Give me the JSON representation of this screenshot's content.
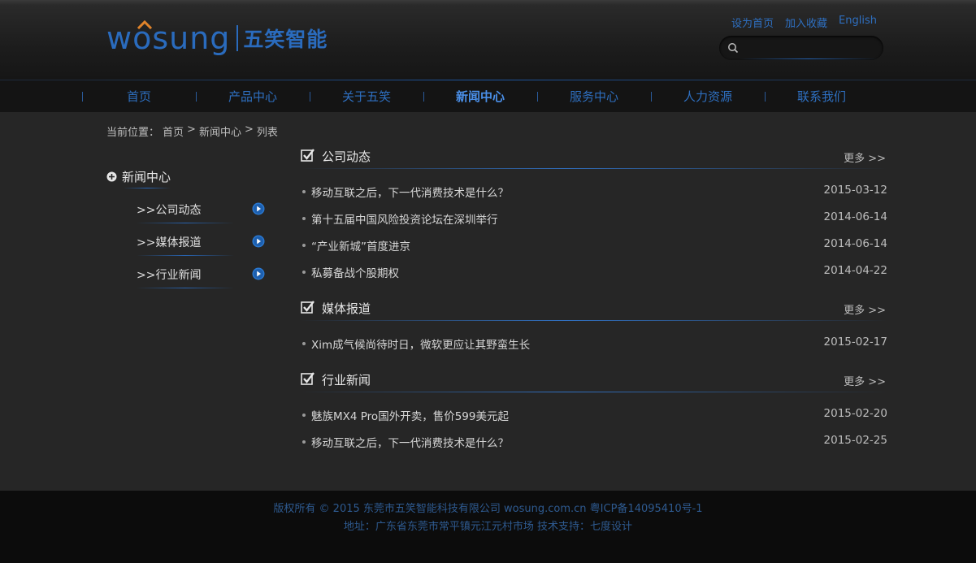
{
  "header": {
    "logo_en": "wosung",
    "logo_cn": "五笑智能",
    "top_links": [
      "设为首页",
      "加入收藏",
      "English"
    ],
    "search": {
      "value": "",
      "placeholder": ""
    }
  },
  "nav": {
    "items": [
      "首页",
      "产品中心",
      "关于五笑",
      "新闻中心",
      "服务中心",
      "人力资源",
      "联系我们"
    ],
    "active": "新闻中心"
  },
  "breadcrumb": {
    "label": "当前位置：",
    "items": [
      "首页",
      "新闻中心",
      "列表"
    ],
    "separator": ">"
  },
  "sidebar": {
    "title": "新闻中心",
    "items": [
      {
        "label": ">>公司动态"
      },
      {
        "label": ">>媒体报道"
      },
      {
        "label": ">>行业新闻"
      }
    ]
  },
  "sections": [
    {
      "title": "公司动态",
      "more": "更多 >>",
      "news": [
        {
          "title": "移动互联之后，下一代消费技术是什么？",
          "date": "2015-03-12"
        },
        {
          "title": "第十五届中国风险投资论坛在深圳举行",
          "date": "2014-06-14"
        },
        {
          "title": "“产业新城”首度进京",
          "date": "2014-06-14"
        },
        {
          "title": "私募备战个股期权",
          "date": "2014-04-22"
        }
      ]
    },
    {
      "title": "媒体报道",
      "more": "更多 >>",
      "news": [
        {
          "title": "Xim成气候尚待时日，微软更应让其野蛮生长",
          "date": "2015-02-17"
        }
      ]
    },
    {
      "title": "行业新闻",
      "more": "更多 >>",
      "news": [
        {
          "title": "魅族MX4 Pro国外开卖，售价599美元起",
          "date": "2015-02-20"
        },
        {
          "title": "移动互联之后，下一代消费技术是什么？",
          "date": "2015-02-25"
        }
      ]
    }
  ],
  "footer": {
    "line1": "版权所有 © 2015 东莞市五笑智能科技有限公司 wosung.com.cn 粤ICP备14095410号-1",
    "line2": "地址：广东省东莞市常平镇元江元村市场   技术支持：七度设计"
  },
  "colors": {
    "brand_blue": "#2a6bbd",
    "nav_active": "#4a8fe8",
    "background": "#262626",
    "footer_bg": "#0c0c0c"
  },
  "icons": [
    "search-icon",
    "plus-circle-icon",
    "arrow-right-circle-icon",
    "checkbox-checked-icon"
  ]
}
